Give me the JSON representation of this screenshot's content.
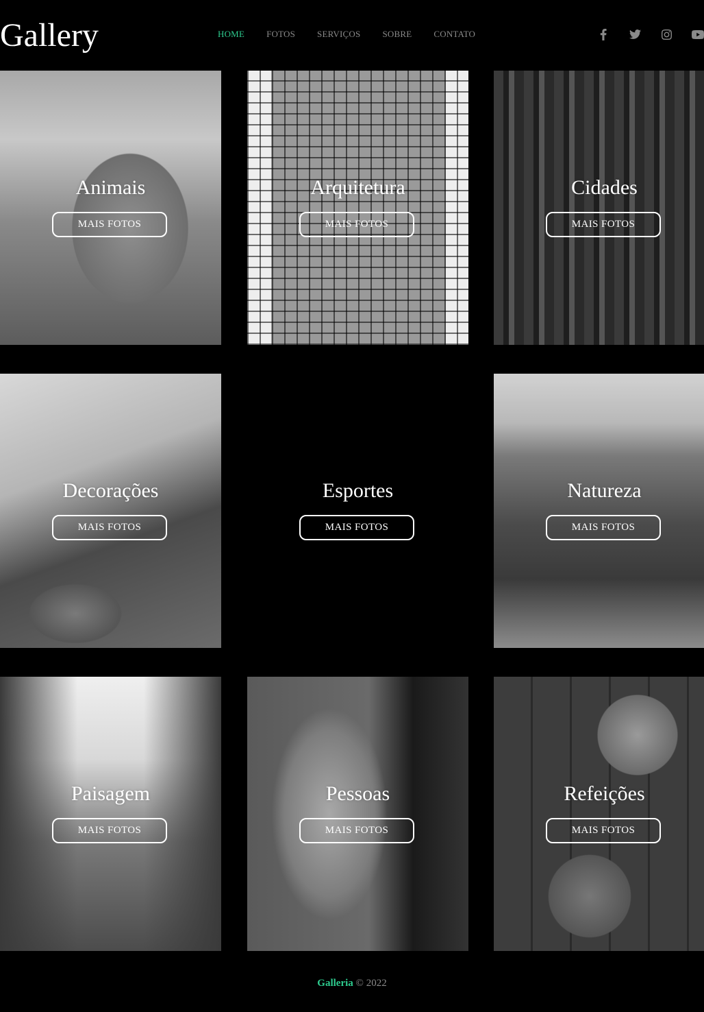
{
  "header": {
    "logo": "Gallery",
    "nav": [
      {
        "label": "HOME",
        "active": true
      },
      {
        "label": "FOTOS",
        "active": false
      },
      {
        "label": "SERVIÇOS",
        "active": false
      },
      {
        "label": "SOBRE",
        "active": false
      },
      {
        "label": "CONTATO",
        "active": false
      }
    ],
    "social": [
      "facebook-icon",
      "twitter-icon",
      "instagram-icon",
      "youtube-icon"
    ]
  },
  "gallery": [
    {
      "title": "Animais",
      "button": "MAIS FOTOS",
      "photo": "elephant"
    },
    {
      "title": "Arquitetura",
      "button": "MAIS FOTOS",
      "photo": "glass-skyscraper"
    },
    {
      "title": "Cidades",
      "button": "MAIS FOTOS",
      "photo": "city-skyline"
    },
    {
      "title": "Decorações",
      "button": "MAIS FOTOS",
      "photo": "cafe-table-laptop"
    },
    {
      "title": "Esportes",
      "button": "MAIS FOTOS",
      "photo": "none"
    },
    {
      "title": "Natureza",
      "button": "MAIS FOTOS",
      "photo": "cliff-waterfall"
    },
    {
      "title": "Paisagem",
      "button": "MAIS FOTOS",
      "photo": "railway-forest"
    },
    {
      "title": "Pessoas",
      "button": "MAIS FOTOS",
      "photo": "man-portrait"
    },
    {
      "title": "Refeições",
      "button": "MAIS FOTOS",
      "photo": "breakfast-table"
    }
  ],
  "footer": {
    "brand": "Galleria",
    "copyright": "© 2022"
  },
  "colors": {
    "accent": "#2ecc8f",
    "background": "#000000",
    "nav_text": "#8a8a8a"
  }
}
